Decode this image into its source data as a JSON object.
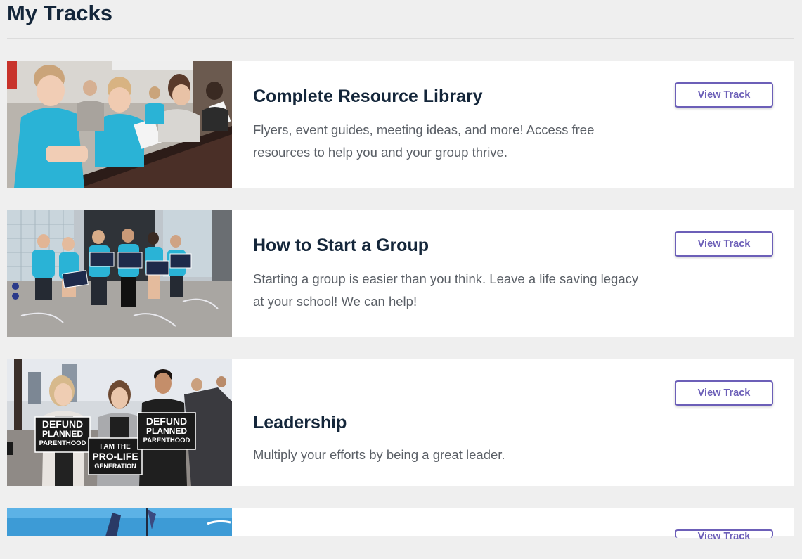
{
  "page": {
    "title": "My Tracks"
  },
  "tracks": [
    {
      "title": "Complete Resource Library",
      "description": "Flyers, event guides, meeting ideas, and more! Access free resources to help you and your group thrive.",
      "button_label": "View Track"
    },
    {
      "title": "How to Start a Group",
      "description": "Starting a group is easier than you think. Leave a life saving legacy at your school! We can help!",
      "button_label": "View Track"
    },
    {
      "title": "Leadership",
      "description": "Multiply your efforts by being a great leader.",
      "button_label": "View Track"
    }
  ],
  "photo_signs": {
    "defund_line1": "DEFUND",
    "defund_line2": "PLANNED",
    "defund_line3": "PARENTHOOD",
    "prolife_line1": "I AM THE",
    "prolife_line2": "PRO-LIFE",
    "prolife_line3": "GENERATION"
  },
  "colors": {
    "page_bg": "#efefef",
    "card_bg": "#ffffff",
    "heading": "#14263a",
    "body_text": "#5a5f66",
    "accent": "#6c5fb8",
    "shirt_blue": "#2ab3d6"
  }
}
